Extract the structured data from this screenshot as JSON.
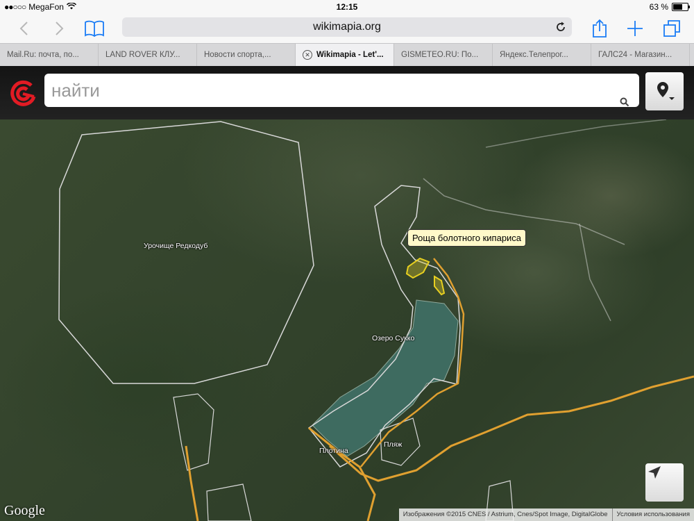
{
  "status_bar": {
    "carrier": "MegaFon",
    "time": "12:15",
    "battery_percent": "63 %",
    "battery_level": 0.63
  },
  "browser": {
    "url": "wikimapia.org",
    "tabs": [
      {
        "label": "Mail.Ru: почта, по...",
        "active": false
      },
      {
        "label": "LAND ROVER КЛУ...",
        "active": false
      },
      {
        "label": "Новости спорта,...",
        "active": false
      },
      {
        "label": "Wikimapia - Let'...",
        "active": true
      },
      {
        "label": "GISMETEO.RU: По...",
        "active": false
      },
      {
        "label": "Яндекс.Телепрог...",
        "active": false
      },
      {
        "label": "ГАЛС24 - Магазин...",
        "active": false
      }
    ]
  },
  "wikimapia": {
    "search_placeholder": "найти",
    "brand_color": "#e21b24"
  },
  "map": {
    "labels": {
      "redkodub": "Урочище Редкодуб",
      "lake": "Озеро Сукко",
      "dam": "Плотина",
      "beach": "Пляж"
    },
    "tooltip": "Роща болотного кипариса",
    "google": "Google",
    "attribution": "Изображения ©2015 CNES / Astrium, Cnes/Spot Image, DigitalGlobe",
    "terms": "Условия использования"
  }
}
